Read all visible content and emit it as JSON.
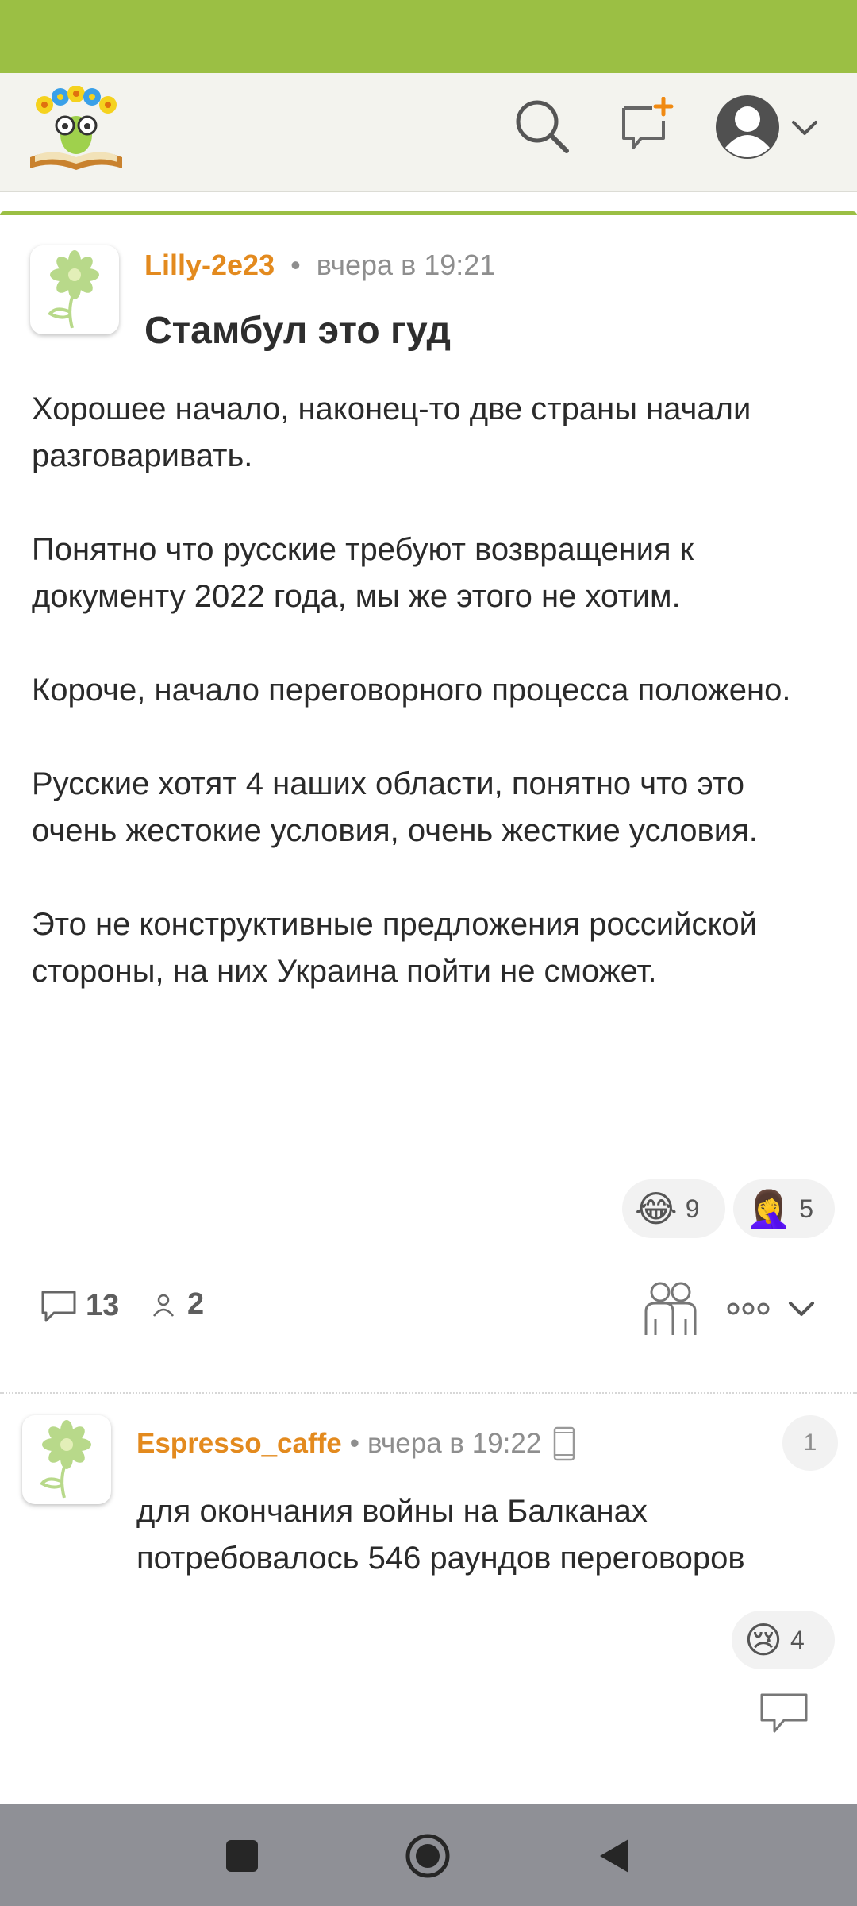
{
  "post": {
    "author": "Lilly-2e23",
    "separator": "•",
    "time": "вчера в 19:21",
    "title": "Стамбул это гуд",
    "paragraphs": [
      "Хорошее начало, наконец-то две страны начали разговаривать.",
      "Понятно что русские требуют возвращения к документу 2022 года, мы же этого не хотим.",
      "Короче, начало переговорного процесса положено.",
      "Русские хотят 4 наших области, понятно что это очень жестокие условия, очень жесткие условия.",
      "Это не конструктивные предложения российской стороны, на них Украина пойти не сможет."
    ],
    "reactions": [
      {
        "emoji": "😂",
        "icon": "tears-of-joy-emoji",
        "count": "9"
      },
      {
        "emoji": "🤦‍♀️",
        "icon": "facepalm-emoji",
        "count": "5"
      }
    ],
    "comments_count": "13",
    "participants_count": "2"
  },
  "comment": {
    "author": "Espresso_caffe",
    "separator": "•",
    "time": "вчера в 19:22",
    "number": "1",
    "text": "для окончания войны на Балканах потребовалось 546 раундов переговоров",
    "reaction": {
      "emoji": "😢",
      "icon": "crying-face-emoji",
      "count": "4"
    }
  },
  "colors": {
    "accent": "#9bbf44",
    "author": "#e38a1e",
    "nav_bar": "#8f9096"
  }
}
